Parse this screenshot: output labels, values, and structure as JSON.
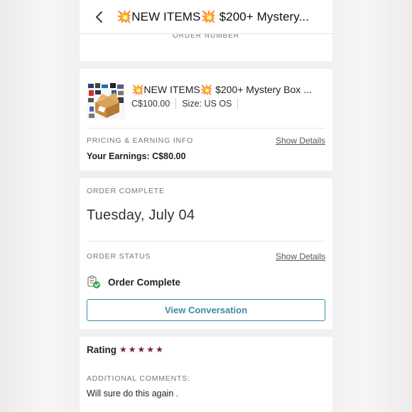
{
  "header": {
    "title": "💥NEW ITEMS💥 $200+ Mystery...",
    "back_icon": "chevron-left-icon"
  },
  "top_card": {
    "label": "ORDER NUMBER"
  },
  "item": {
    "title": "💥NEW ITEMS💥 $200+ Mystery Box ...",
    "price": "C$100.00",
    "size": "Size: US OS"
  },
  "pricing": {
    "label": "PRICING & EARNING INFO",
    "details_link": "Show Details",
    "earnings_label": "Your Earnings:",
    "earnings_value": "C$80.00"
  },
  "order": {
    "complete_label": "ORDER COMPLETE",
    "date": "Tuesday, July 04",
    "status_label": "ORDER STATUS",
    "details_link": "Show Details",
    "status_text": "Order Complete",
    "status_icon": "clipboard-check-icon",
    "button_label": "View Conversation"
  },
  "rating": {
    "label": "Rating",
    "stars": 5,
    "comments_label": "ADDITIONAL COMMENTS:",
    "comment": "Will sure do this again ."
  },
  "colors": {
    "accent": "#3b8ea5",
    "star": "#7a2230",
    "check": "#3aa657"
  }
}
